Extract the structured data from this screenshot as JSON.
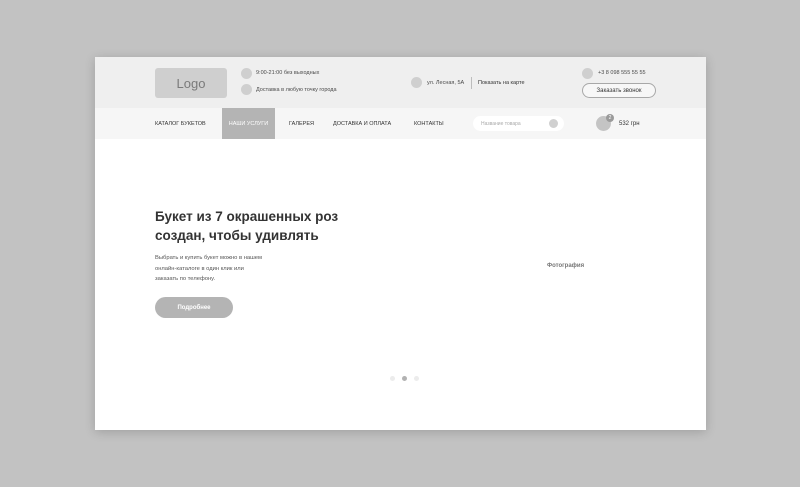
{
  "header": {
    "logo": "Logo",
    "hours": "9:00-21:00  без выходных",
    "delivery": "Доставка в любую точку города",
    "address": "ул. Лесная, 5А",
    "show_on_map": "Показать на карте",
    "phone": "+3 8 098 555 55 55",
    "callback": "Заказать звонок"
  },
  "nav": {
    "items": [
      {
        "label": "КАТАЛОГ БУКЕТОВ"
      },
      {
        "label": "НАШИ УСЛУГИ"
      },
      {
        "label": "ГАЛЕРЕЯ"
      },
      {
        "label": "ДОСТАВКА И ОПЛАТА"
      },
      {
        "label": "КОНТАКТЫ"
      }
    ],
    "active_index": 1,
    "search_placeholder": "Название товара",
    "cart_count": "2",
    "cart_total": "532 грн"
  },
  "hero": {
    "title_line1": "Букет из 7 окрашенных роз",
    "title_line2": "создан, чтобы удивлять",
    "desc_line1": "Выбрать и купить букет можно в нашем",
    "desc_line2": "онлайн-каталоге в один клик или",
    "desc_line3": "заказать по телефону.",
    "button": "Подробнее",
    "photo_label": "Фотография"
  },
  "slider": {
    "total": 3,
    "active": 2
  }
}
